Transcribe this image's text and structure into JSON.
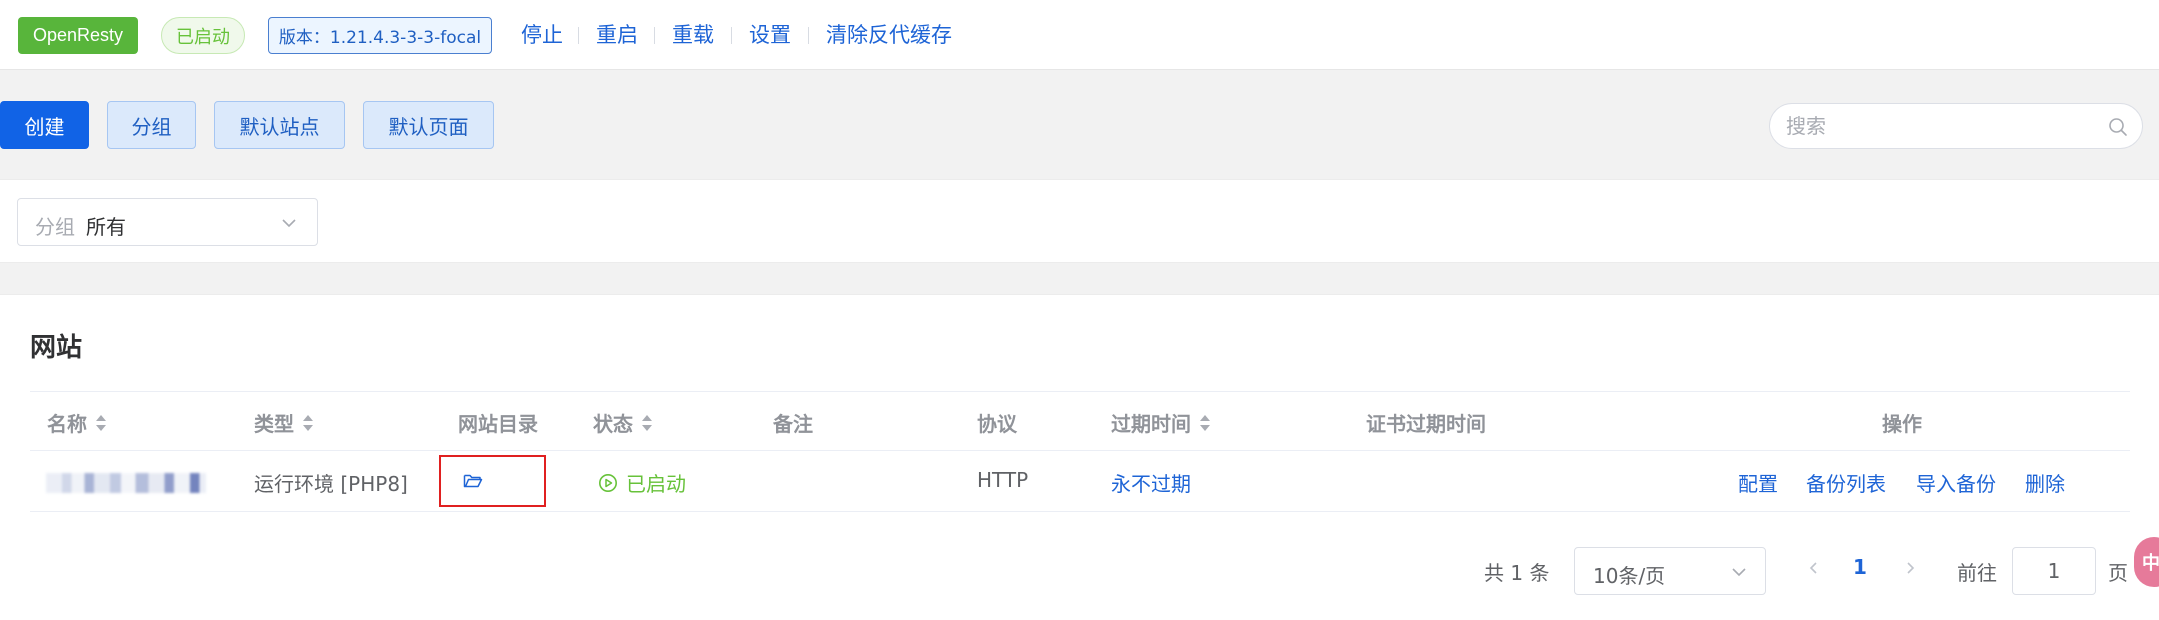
{
  "topbar": {
    "brand": "OpenResty",
    "status": "已启动",
    "version": "版本：1.21.4.3-3-3-focal",
    "actions": [
      "停止",
      "重启",
      "重载",
      "设置",
      "清除反代缓存"
    ]
  },
  "toolbar": {
    "create": "创建",
    "group": "分组",
    "default_site": "默认站点",
    "default_page": "默认页面",
    "search_placeholder": "搜索"
  },
  "filter": {
    "prefix": "分组",
    "value": "所有"
  },
  "sites": {
    "title": "网站",
    "columns": {
      "name": "名称",
      "type": "类型",
      "dir": "网站目录",
      "status": "状态",
      "remark": "备注",
      "protocol": "协议",
      "expire": "过期时间",
      "cert_expire": "证书过期时间",
      "actions": "操作"
    },
    "rows": [
      {
        "type": "运行环境 [PHP8]",
        "status": "已启动",
        "remark": "",
        "protocol": "HTTP",
        "expire": "永不过期",
        "cert_expire": "",
        "actions": [
          "配置",
          "备份列表",
          "导入备份",
          "删除"
        ]
      }
    ]
  },
  "pagination": {
    "total": "共 1 条",
    "page_size": "10条/页",
    "current": "1",
    "goto_label": "前往",
    "goto_value": "1",
    "page_suffix": "页"
  },
  "colors": {
    "primary": "#1163e6",
    "success": "#67c23a",
    "brand": "#58b53b",
    "link": "#1e64d6",
    "highlight_border": "#e02020"
  },
  "icons": {
    "search": "search-icon",
    "folder": "folder-open-icon",
    "status": "play-circle-icon",
    "dropdown": "chevron-down-icon"
  },
  "floating_widget": "中"
}
